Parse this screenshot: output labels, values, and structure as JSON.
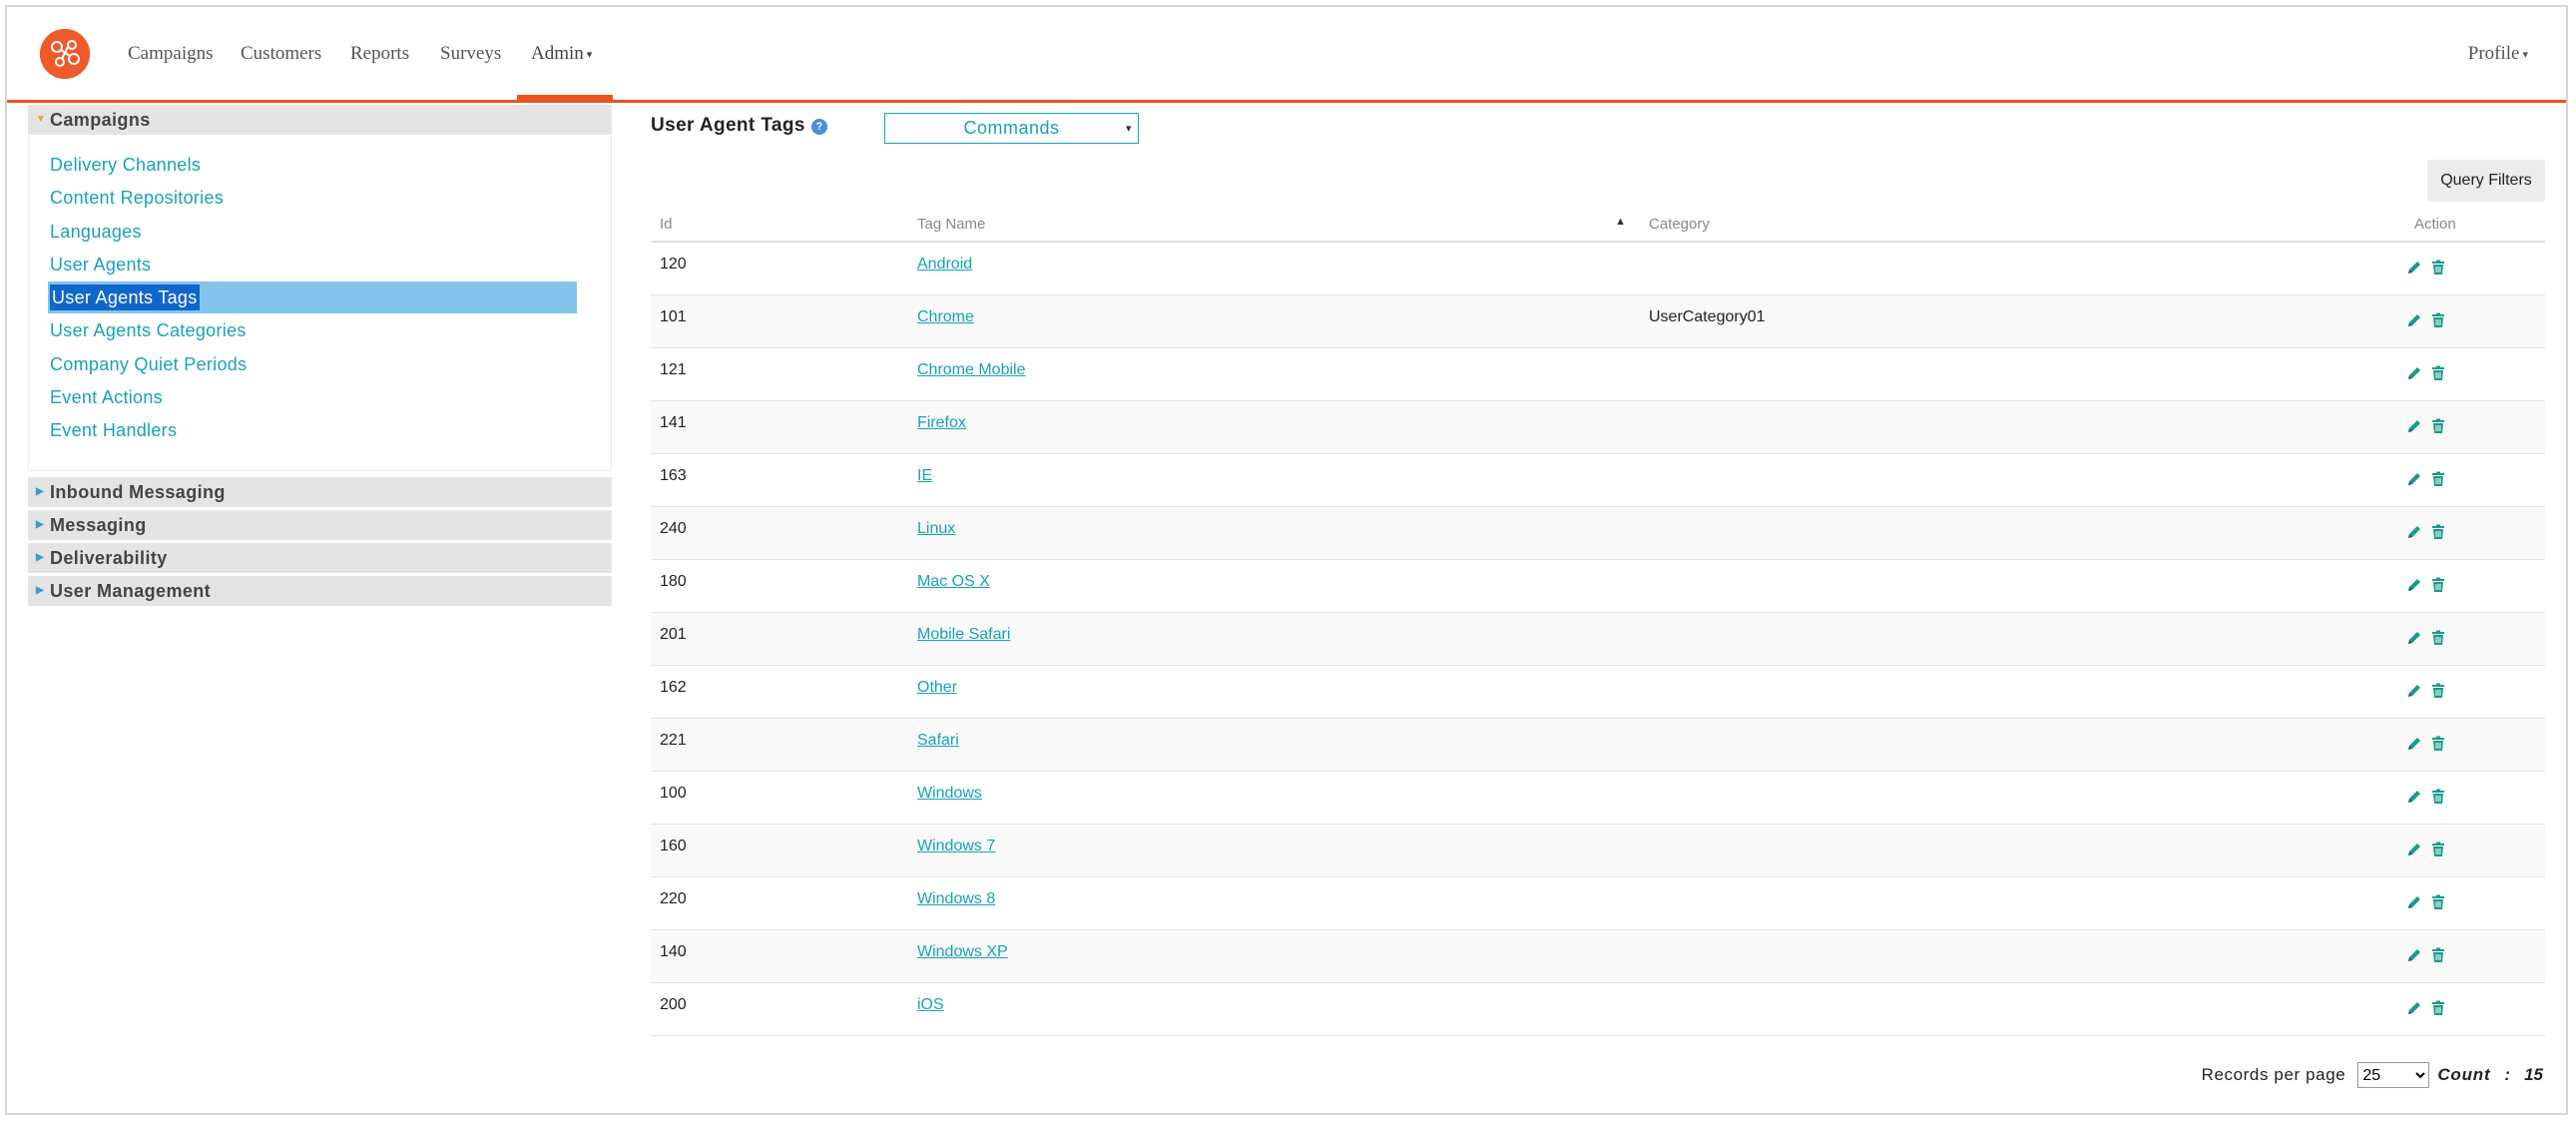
{
  "nav": {
    "items": [
      {
        "label": "Campaigns"
      },
      {
        "label": "Customers"
      },
      {
        "label": "Reports"
      },
      {
        "label": "Surveys"
      },
      {
        "label": "Admin"
      }
    ],
    "profile": "Profile"
  },
  "sidebar": {
    "sections": [
      {
        "title": "Campaigns",
        "expanded": true,
        "items": [
          "Delivery Channels",
          "Content Repositories",
          "Languages",
          "User Agents",
          "User Agents Tags",
          "User Agents Categories",
          "Company Quiet Periods",
          "Event Actions",
          "Event Handlers"
        ],
        "selected": "User Agents Tags"
      },
      {
        "title": "Inbound Messaging"
      },
      {
        "title": "Messaging"
      },
      {
        "title": "Deliverability"
      },
      {
        "title": "User Management"
      }
    ]
  },
  "main": {
    "title": "User Agent Tags",
    "help": "?",
    "commands": "Commands",
    "query_filters": "Query Filters",
    "columns": {
      "id": "Id",
      "tag_name": "Tag Name",
      "category": "Category",
      "action": "Action"
    },
    "rows": [
      {
        "id": "120",
        "tag": "Android",
        "category": ""
      },
      {
        "id": "101",
        "tag": "Chrome",
        "category": "UserCategory01"
      },
      {
        "id": "121",
        "tag": "Chrome Mobile",
        "category": ""
      },
      {
        "id": "141",
        "tag": "Firefox",
        "category": ""
      },
      {
        "id": "163",
        "tag": "IE",
        "category": ""
      },
      {
        "id": "240",
        "tag": "Linux",
        "category": ""
      },
      {
        "id": "180",
        "tag": "Mac OS X",
        "category": ""
      },
      {
        "id": "201",
        "tag": "Mobile Safari",
        "category": ""
      },
      {
        "id": "162",
        "tag": "Other",
        "category": ""
      },
      {
        "id": "221",
        "tag": "Safari",
        "category": ""
      },
      {
        "id": "100",
        "tag": "Windows",
        "category": ""
      },
      {
        "id": "160",
        "tag": "Windows 7",
        "category": ""
      },
      {
        "id": "220",
        "tag": "Windows 8",
        "category": ""
      },
      {
        "id": "140",
        "tag": "Windows XP",
        "category": ""
      },
      {
        "id": "200",
        "tag": "iOS",
        "category": ""
      }
    ],
    "pager": {
      "records_label": "Records per page",
      "per_page": "25",
      "count_label": "Count",
      "count_sep": ":",
      "count": "15"
    }
  },
  "colors": {
    "accent": "#e8541c",
    "link": "#17a2b8",
    "selected_bg": "#82c4ec"
  }
}
